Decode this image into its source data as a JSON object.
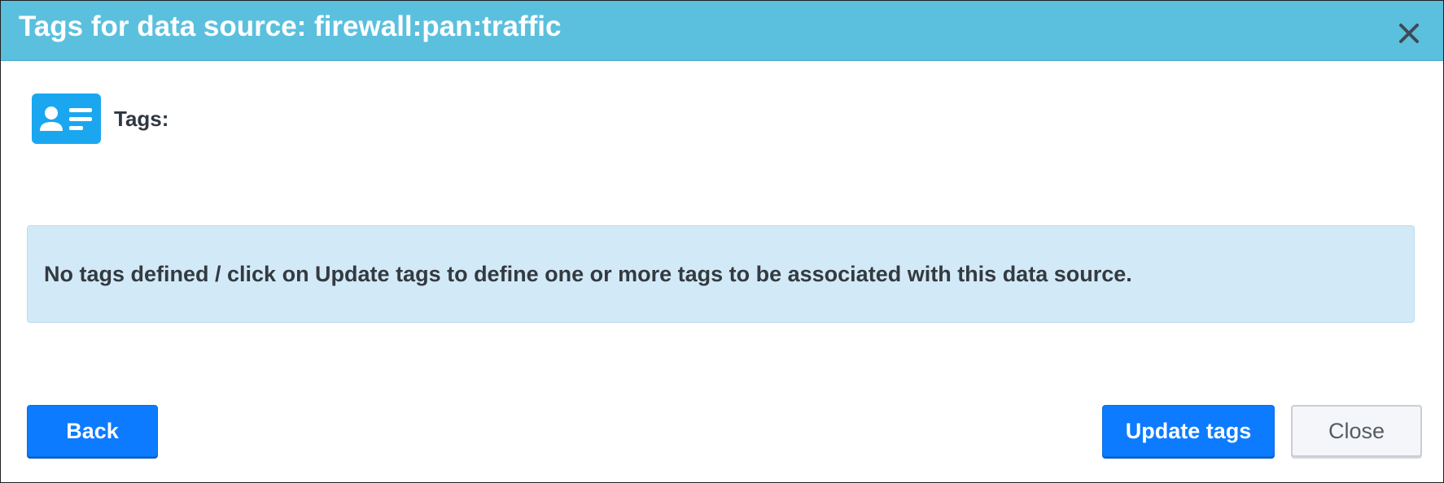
{
  "dialog": {
    "title": "Tags for data source: firewall:pan:traffic",
    "close_icon": "close-icon"
  },
  "tags": {
    "label": "Tags:",
    "icon": "id-card-icon",
    "empty_message": "No tags defined / click on Update tags to define one or more tags to be associated with this data source."
  },
  "footer": {
    "back_label": "Back",
    "update_label": "Update tags",
    "close_label": "Close"
  },
  "colors": {
    "header": "#5bc0de",
    "primary": "#0d7bff",
    "info_bg": "#d2eaf8",
    "icon": "#1aa7f0"
  }
}
